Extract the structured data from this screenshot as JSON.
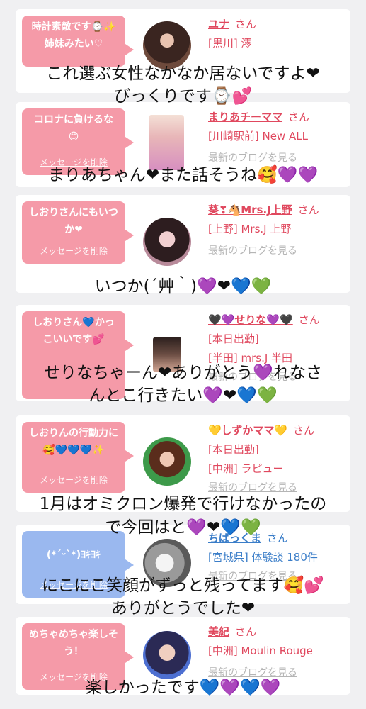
{
  "delete_label": "メッセージを削除",
  "blog_label": "最新のブログを見る",
  "honorific": "さん",
  "cards": [
    {
      "message": "時計素敵です⌚✨姉妹みたい♡",
      "name": "ユナ",
      "location": "[黒川] 澪"
    },
    {
      "message": "コロナに負けるな😊",
      "name": "まりあチーママ",
      "location": "[川崎駅前] New ALL"
    },
    {
      "message": "しおりさんにもいつか❤",
      "name": "葵❣🐴Mrs.J上野",
      "location": "[上野] Mrs.J 上野"
    },
    {
      "message": "しおりさん💙かっこいいです💕",
      "name": "🖤💜せりな💜🖤",
      "status": "[本日出勤]",
      "location": "[半田] mrs.J 半田"
    },
    {
      "message": "しおりんの行動力に🥰💙💙💙✨",
      "name": "💛しずかママ💛",
      "status": "[本日出勤]",
      "location": "[中洲] ラピュー"
    },
    {
      "message": "(*´ᵕ`*)ﾖｷﾖｷ",
      "name": "ちばっくま",
      "location": "[宮城県] 体験談 180件"
    },
    {
      "message": "めちゃめちゃ楽しそう！",
      "name": "美紀",
      "location": "[中洲] Moulin Rouge"
    }
  ],
  "overlays": [
    "これ選ぶ女性なかなか居ないですよ❤",
    "びっくりです⌚💕",
    "まりあちゃん❤また話そうね🥰💜💜",
    "いつか(´艸｀)💜❤💙💚",
    "せりなちゃーん❤ありがとう💜れなさ",
    "んとこ行きたい💜❤💙💚",
    "1月はオミクロン爆発で行けなかったの",
    "で今回はと💜❤💙💚",
    "にこにこ笑顔がずっと残ってます🥰💕",
    "ありがとうでした❤",
    "楽しかったです💙💜💙💜"
  ],
  "colors": {
    "bubble_pink": "#f59aa8",
    "bubble_blue": "#9ab8ef",
    "name_pink": "#e0485e",
    "name_blue": "#3a7dc8"
  }
}
